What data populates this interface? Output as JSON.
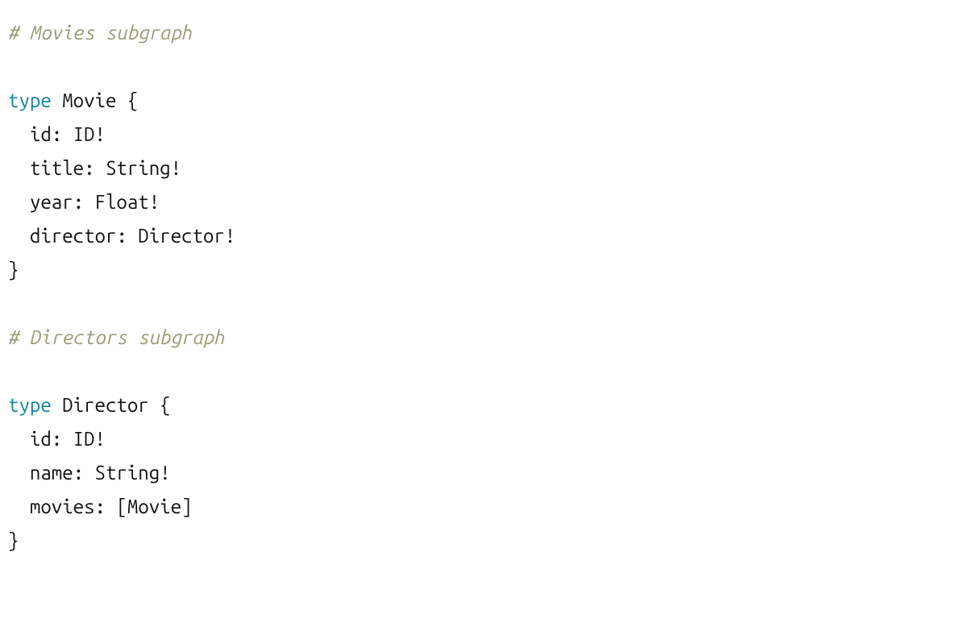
{
  "code": {
    "comment1": "# Movies subgraph",
    "blank1": "",
    "line1_kw": "type",
    "line1_rest": " Movie {",
    "line2": "  id: ID!",
    "line3": "  title: String!",
    "line4": "  year: Float!",
    "line5": "  director: Director!",
    "line6": "}",
    "blank2": "",
    "comment2": "# Directors subgraph",
    "blank3": "",
    "line7_kw": "type",
    "line7_rest": " Director {",
    "line8": "  id: ID!",
    "line9": "  name: String!",
    "line10": "  movies: [Movie]",
    "line11": "}"
  }
}
